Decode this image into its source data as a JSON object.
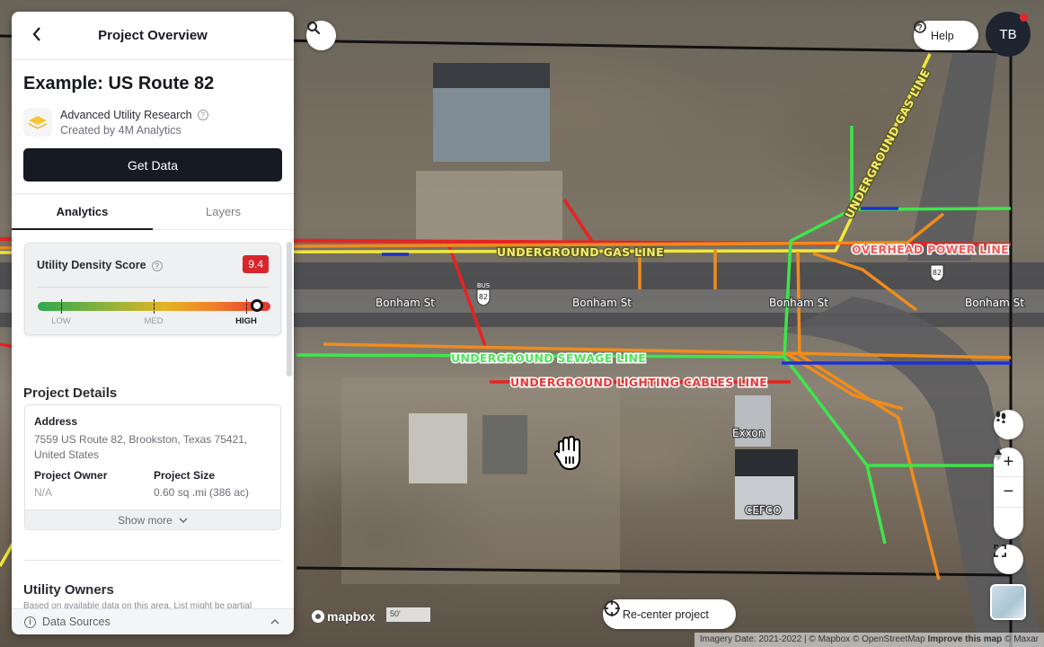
{
  "panel": {
    "header_title": "Project Overview",
    "project_title": "Example: US Route 82",
    "product": {
      "name": "Advanced Utility Research",
      "creator": "Created by 4M Analytics"
    },
    "get_data_label": "Get Data",
    "tabs": [
      {
        "label": "Analytics",
        "active": true
      },
      {
        "label": "Layers",
        "active": false
      }
    ],
    "density": {
      "label": "Utility Density Score",
      "score": "9.4",
      "score_value": 9.4,
      "scale_max": 10,
      "levels": [
        {
          "label": "LOW",
          "active": false
        },
        {
          "label": "MED",
          "active": false
        },
        {
          "label": "HIGH",
          "active": true
        }
      ],
      "badge_color": "#d8262a"
    },
    "project_details": {
      "title": "Project Details",
      "address_label": "Address",
      "address_value": "7559 US Route 82, Brookston, Texas 75421, United States",
      "owner_label": "Project Owner",
      "owner_value": "N/A",
      "size_label": "Project Size",
      "size_value": "0.60 sq .mi (386 ac)",
      "show_more_label": "Show more"
    },
    "utility_owners": {
      "title": "Utility Owners",
      "subtitle": "Based on available data on this area. List might be partial"
    },
    "data_sources_label": "Data Sources"
  },
  "map": {
    "help_label": "Help",
    "avatar_initials": "TB",
    "recenter_label": "Re-center project",
    "mapbox_logo": "mapbox",
    "scale_label": "50'",
    "attribution": {
      "imagery": "Imagery Date: 2021-2022 | © Mapbox © OpenStreetMap",
      "improve": "Improve this map",
      "maxar": "© Maxar"
    },
    "road_labels": [
      "Bonham St",
      "Bonham St",
      "Bonham St",
      "Bonham St"
    ],
    "shields": [
      "82",
      "82"
    ],
    "shield_bus": "BUS",
    "poi_labels": [
      "Exxon",
      "CEFCO"
    ],
    "utility_labels": {
      "gas_horizontal": "UNDERGROUND GAS LINE",
      "gas_diagonal": "UNDERGROUND GAS LINE",
      "power": "OVERHEAD POWER LINE",
      "sewage": "UNDERGROUND SEWAGE LINE",
      "lighting": "UNDERGROUND LIGHTING CABLES LINE"
    },
    "utility_colors": {
      "gas": "#f2e83a",
      "power": "#e8221f",
      "sewage": "#3ee64b",
      "lighting": "#e8221f",
      "telecom": "#f08c1c",
      "water": "#1a2fd6"
    }
  }
}
